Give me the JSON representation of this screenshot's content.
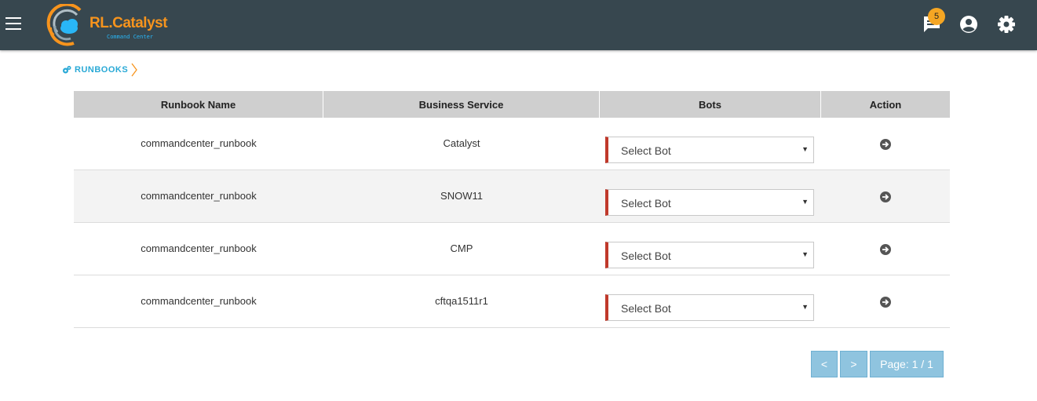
{
  "header": {
    "menu_icon": "hamburger-menu-icon",
    "logo": {
      "brand": "RL.Catalyst",
      "brand_rl": "RL.",
      "brand_catalyst": "Catalyst",
      "tagline": "Command Center"
    },
    "notifications": {
      "icon": "chat-bubble-icon",
      "count": "5"
    },
    "user_icon": "account-circle-icon",
    "settings_icon": "gear-icon",
    "colors": {
      "bar": "#37474f",
      "brand": "#f7941d",
      "badge": "#f5a623"
    }
  },
  "breadcrumb": {
    "icon": "cogs-icon",
    "label": "RUNBOOKS"
  },
  "table": {
    "headers": [
      "Runbook Name",
      "Business Service",
      "Bots",
      "Action"
    ],
    "rows": [
      {
        "name": "commandcenter_runbook",
        "service": "Catalyst",
        "bot": "Select Bot"
      },
      {
        "name": "commandcenter_runbook",
        "service": "SNOW11",
        "bot": "Select Bot"
      },
      {
        "name": "commandcenter_runbook",
        "service": "CMP",
        "bot": "Select Bot"
      },
      {
        "name": "commandcenter_runbook",
        "service": "cftqa1511r1",
        "bot": "Select Bot"
      }
    ],
    "action_icon": "arrow-right-circle-icon"
  },
  "pagination": {
    "prev": "<",
    "next": ">",
    "page": "Page: 1 / 1"
  }
}
